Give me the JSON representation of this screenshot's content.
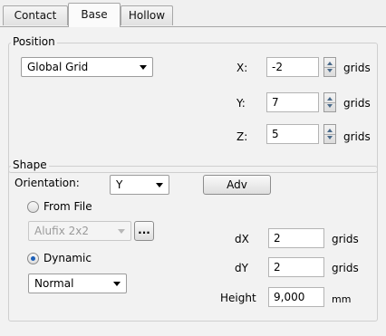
{
  "tabs": [
    {
      "label": "Contact"
    },
    {
      "label": "Base"
    },
    {
      "label": "Hollow"
    }
  ],
  "active_tab": "Base",
  "position": {
    "legend": "Position",
    "grid_combo": "Global Grid",
    "x": {
      "label": "X:",
      "value": "-2",
      "unit": "grids"
    },
    "y": {
      "label": "Y:",
      "value": "7",
      "unit": "grids"
    },
    "z": {
      "label": "Z:",
      "value": "5",
      "unit": "grids"
    }
  },
  "shape": {
    "legend": "Shape",
    "orientation_label": "Orientation:",
    "orientation_value": "Y",
    "adv_button": "Adv",
    "from_file_label": "From File",
    "from_file_combo": "Alufix 2x2",
    "browse_button": "...",
    "dynamic_label": "Dynamic",
    "dynamic_combo": "Normal",
    "dx": {
      "label": "dX",
      "value": "2",
      "unit": "grids"
    },
    "dy": {
      "label": "dY",
      "value": "2",
      "unit": "grids"
    },
    "height": {
      "label": "Height",
      "value": "9,000",
      "unit": "mm"
    }
  }
}
